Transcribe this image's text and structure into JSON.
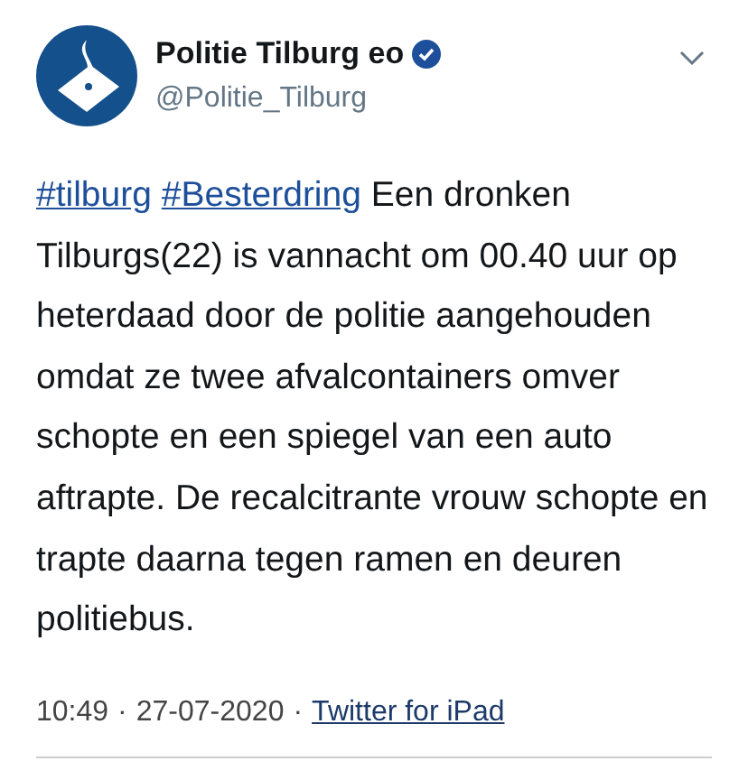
{
  "author": {
    "name": "Politie Tilburg eo",
    "verified": true,
    "handle": "@Politie_Tilburg"
  },
  "tweet": {
    "segments": [
      {
        "kind": "hashtag",
        "text": "#tilburg"
      },
      {
        "kind": "hashtag",
        "text": "#Besterdring"
      },
      {
        "kind": "text",
        "text": "Een dronken Tilburgs(22) is vannacht om 00.40 uur op heterdaad door de politie aangehouden omdat ze twee afvalcontainers omver schopte en een spiegel van een auto aftrapte. De recalcitrante vrouw schopte en trapte daarna tegen ramen en deuren politiebus."
      }
    ]
  },
  "footer": {
    "time": "10:49",
    "separator_1": "·",
    "date": "27-07-2020",
    "separator_2": "·",
    "source": "Twitter for iPad"
  }
}
